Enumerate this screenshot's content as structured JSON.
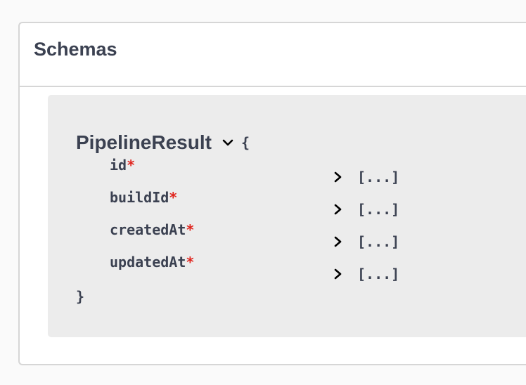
{
  "section": {
    "title": "Schemas"
  },
  "model": {
    "name": "PipelineResult",
    "open_brace": "{",
    "close_brace": "}",
    "required_marker": "*",
    "properties": [
      {
        "name": "id",
        "value": "[...]"
      },
      {
        "name": "buildId",
        "value": "[...]"
      },
      {
        "name": "createdAt",
        "value": "[...]"
      },
      {
        "name": "updatedAt",
        "value": "[...]"
      }
    ]
  },
  "colors": {
    "text": "#3b4151",
    "required": "#e0241d",
    "model_background": "#ececec",
    "border": "#d6d6d6"
  }
}
